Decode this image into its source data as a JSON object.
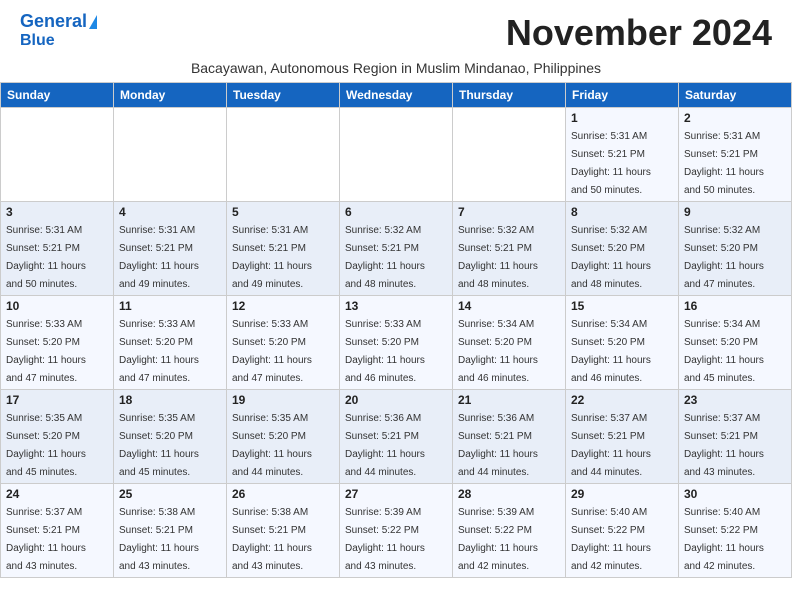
{
  "header": {
    "logo_line1": "General",
    "logo_line2": "Blue",
    "month_title": "November 2024",
    "subtitle": "Bacayawan, Autonomous Region in Muslim Mindanao, Philippines"
  },
  "weekdays": [
    "Sunday",
    "Monday",
    "Tuesday",
    "Wednesday",
    "Thursday",
    "Friday",
    "Saturday"
  ],
  "weeks": [
    [
      {
        "day": "",
        "info": ""
      },
      {
        "day": "",
        "info": ""
      },
      {
        "day": "",
        "info": ""
      },
      {
        "day": "",
        "info": ""
      },
      {
        "day": "",
        "info": ""
      },
      {
        "day": "1",
        "info": "Sunrise: 5:31 AM\nSunset: 5:21 PM\nDaylight: 11 hours\nand 50 minutes."
      },
      {
        "day": "2",
        "info": "Sunrise: 5:31 AM\nSunset: 5:21 PM\nDaylight: 11 hours\nand 50 minutes."
      }
    ],
    [
      {
        "day": "3",
        "info": "Sunrise: 5:31 AM\nSunset: 5:21 PM\nDaylight: 11 hours\nand 50 minutes."
      },
      {
        "day": "4",
        "info": "Sunrise: 5:31 AM\nSunset: 5:21 PM\nDaylight: 11 hours\nand 49 minutes."
      },
      {
        "day": "5",
        "info": "Sunrise: 5:31 AM\nSunset: 5:21 PM\nDaylight: 11 hours\nand 49 minutes."
      },
      {
        "day": "6",
        "info": "Sunrise: 5:32 AM\nSunset: 5:21 PM\nDaylight: 11 hours\nand 48 minutes."
      },
      {
        "day": "7",
        "info": "Sunrise: 5:32 AM\nSunset: 5:21 PM\nDaylight: 11 hours\nand 48 minutes."
      },
      {
        "day": "8",
        "info": "Sunrise: 5:32 AM\nSunset: 5:20 PM\nDaylight: 11 hours\nand 48 minutes."
      },
      {
        "day": "9",
        "info": "Sunrise: 5:32 AM\nSunset: 5:20 PM\nDaylight: 11 hours\nand 47 minutes."
      }
    ],
    [
      {
        "day": "10",
        "info": "Sunrise: 5:33 AM\nSunset: 5:20 PM\nDaylight: 11 hours\nand 47 minutes."
      },
      {
        "day": "11",
        "info": "Sunrise: 5:33 AM\nSunset: 5:20 PM\nDaylight: 11 hours\nand 47 minutes."
      },
      {
        "day": "12",
        "info": "Sunrise: 5:33 AM\nSunset: 5:20 PM\nDaylight: 11 hours\nand 47 minutes."
      },
      {
        "day": "13",
        "info": "Sunrise: 5:33 AM\nSunset: 5:20 PM\nDaylight: 11 hours\nand 46 minutes."
      },
      {
        "day": "14",
        "info": "Sunrise: 5:34 AM\nSunset: 5:20 PM\nDaylight: 11 hours\nand 46 minutes."
      },
      {
        "day": "15",
        "info": "Sunrise: 5:34 AM\nSunset: 5:20 PM\nDaylight: 11 hours\nand 46 minutes."
      },
      {
        "day": "16",
        "info": "Sunrise: 5:34 AM\nSunset: 5:20 PM\nDaylight: 11 hours\nand 45 minutes."
      }
    ],
    [
      {
        "day": "17",
        "info": "Sunrise: 5:35 AM\nSunset: 5:20 PM\nDaylight: 11 hours\nand 45 minutes."
      },
      {
        "day": "18",
        "info": "Sunrise: 5:35 AM\nSunset: 5:20 PM\nDaylight: 11 hours\nand 45 minutes."
      },
      {
        "day": "19",
        "info": "Sunrise: 5:35 AM\nSunset: 5:20 PM\nDaylight: 11 hours\nand 44 minutes."
      },
      {
        "day": "20",
        "info": "Sunrise: 5:36 AM\nSunset: 5:21 PM\nDaylight: 11 hours\nand 44 minutes."
      },
      {
        "day": "21",
        "info": "Sunrise: 5:36 AM\nSunset: 5:21 PM\nDaylight: 11 hours\nand 44 minutes."
      },
      {
        "day": "22",
        "info": "Sunrise: 5:37 AM\nSunset: 5:21 PM\nDaylight: 11 hours\nand 44 minutes."
      },
      {
        "day": "23",
        "info": "Sunrise: 5:37 AM\nSunset: 5:21 PM\nDaylight: 11 hours\nand 43 minutes."
      }
    ],
    [
      {
        "day": "24",
        "info": "Sunrise: 5:37 AM\nSunset: 5:21 PM\nDaylight: 11 hours\nand 43 minutes."
      },
      {
        "day": "25",
        "info": "Sunrise: 5:38 AM\nSunset: 5:21 PM\nDaylight: 11 hours\nand 43 minutes."
      },
      {
        "day": "26",
        "info": "Sunrise: 5:38 AM\nSunset: 5:21 PM\nDaylight: 11 hours\nand 43 minutes."
      },
      {
        "day": "27",
        "info": "Sunrise: 5:39 AM\nSunset: 5:22 PM\nDaylight: 11 hours\nand 43 minutes."
      },
      {
        "day": "28",
        "info": "Sunrise: 5:39 AM\nSunset: 5:22 PM\nDaylight: 11 hours\nand 42 minutes."
      },
      {
        "day": "29",
        "info": "Sunrise: 5:40 AM\nSunset: 5:22 PM\nDaylight: 11 hours\nand 42 minutes."
      },
      {
        "day": "30",
        "info": "Sunrise: 5:40 AM\nSunset: 5:22 PM\nDaylight: 11 hours\nand 42 minutes."
      }
    ]
  ]
}
